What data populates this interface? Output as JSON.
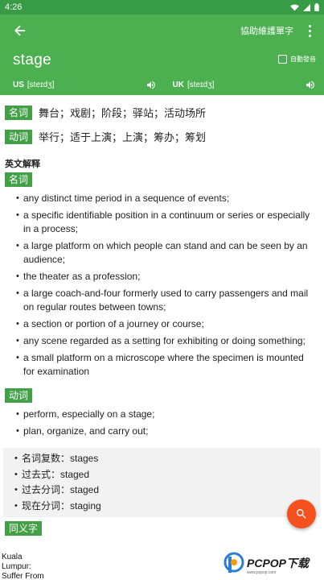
{
  "status": {
    "time": "4:26"
  },
  "header": {
    "help_label": "協助維護單字",
    "word": "stage",
    "autoplay_label": "自動發音",
    "us_label": "US",
    "us_ipa": "[steɪdʒ]",
    "uk_label": "UK",
    "uk_ipa": "[steɪdʒ]"
  },
  "basic": [
    {
      "tag": "名词",
      "text": "舞台；戏剧；阶段；驿站；活动场所"
    },
    {
      "tag": "动词",
      "text": "举行；适于上演；上演；筹办；筹划"
    }
  ],
  "english": {
    "title": "英文解释",
    "noun_tag": "名词",
    "noun_defs": [
      "any distinct time period in a sequence of events;",
      "a specific identifiable position in a continuum or series or especially in a process;",
      "a large platform on which people can stand and can be seen by an audience;",
      "the theater as a profession;",
      "a large coach-and-four formerly used to carry passengers and mail on regular routes between towns;",
      "a section or portion of a journey or course;",
      "any scene regarded as a setting for exhibiting or doing something;",
      "a small platform on a microscope where the specimen is mounted for examination"
    ],
    "verb_tag": "动词",
    "verb_defs": [
      "perform, especially on a stage;",
      "plan, organize, and carry out;"
    ]
  },
  "forms": [
    "名词复数：stages",
    "过去式：staged",
    "过去分词：staged",
    "现在分词：staging"
  ],
  "synonym": {
    "tag": "同义字",
    "lines": [
      "Kuala",
      "Lumpur:",
      "Suffer From"
    ]
  },
  "watermark": {
    "text": "PCPOP下载",
    "sub": "www.pcpop.com"
  },
  "colors": {
    "status_bar": "#389b45",
    "app_bar": "#4caf50",
    "tag": "#43a047",
    "fab": "#f4511e"
  }
}
